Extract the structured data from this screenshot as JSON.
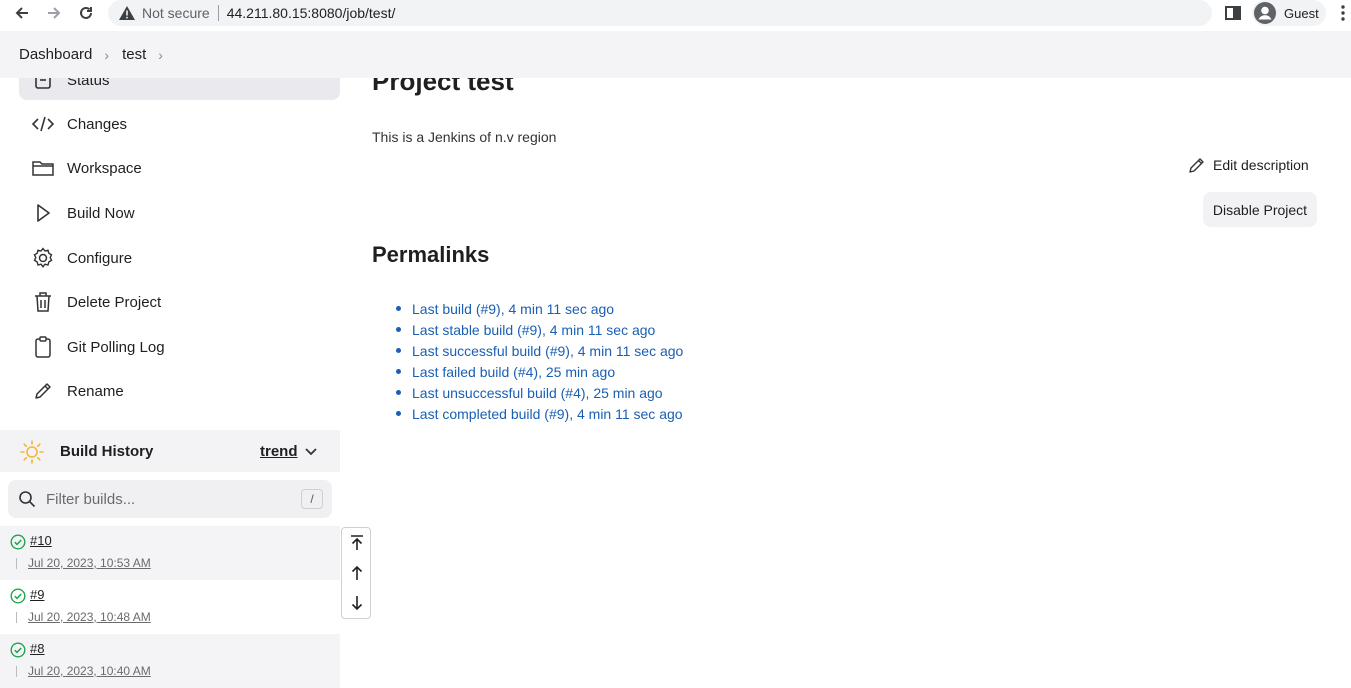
{
  "browser": {
    "security_label": "Not secure",
    "url": "44.211.80.15:8080/job/test/",
    "profile_name": "Guest"
  },
  "breadcrumb": {
    "items": [
      "Dashboard",
      "test"
    ]
  },
  "sidebar": {
    "tasks": [
      {
        "label": "Status",
        "icon": "status-icon"
      },
      {
        "label": "Changes",
        "icon": "code-icon"
      },
      {
        "label": "Workspace",
        "icon": "folder-icon"
      },
      {
        "label": "Build Now",
        "icon": "play-icon"
      },
      {
        "label": "Configure",
        "icon": "gear-icon"
      },
      {
        "label": "Delete Project",
        "icon": "trash-icon"
      },
      {
        "label": "Git Polling Log",
        "icon": "clipboard-icon"
      },
      {
        "label": "Rename",
        "icon": "pencil-icon"
      }
    ]
  },
  "build_history": {
    "title": "Build History",
    "trend_label": "trend",
    "filter_placeholder": "Filter builds...",
    "filter_shortcut": "/",
    "builds": [
      {
        "number": "#10",
        "time": "Jul 20, 2023, 10:53 AM",
        "status": "success"
      },
      {
        "number": "#9",
        "time": "Jul 20, 2023, 10:48 AM",
        "status": "success"
      },
      {
        "number": "#8",
        "time": "Jul 20, 2023, 10:40 AM",
        "status": "success"
      }
    ]
  },
  "main": {
    "title": "Project test",
    "description": "This is a Jenkins of n.v region",
    "edit_description_label": "Edit description",
    "disable_button_label": "Disable Project",
    "permalinks_title": "Permalinks",
    "permalinks": [
      "Last build (#9), 4 min 11 sec ago",
      "Last stable build (#9), 4 min 11 sec ago",
      "Last successful build (#9), 4 min 11 sec ago",
      "Last failed build (#4), 25 min ago",
      "Last unsuccessful build (#4), 25 min ago",
      "Last completed build (#9), 4 min 11 sec ago"
    ]
  },
  "colors": {
    "link": "#1a5fb4",
    "success": "#1ea64b",
    "sun": "#f0b73a"
  }
}
